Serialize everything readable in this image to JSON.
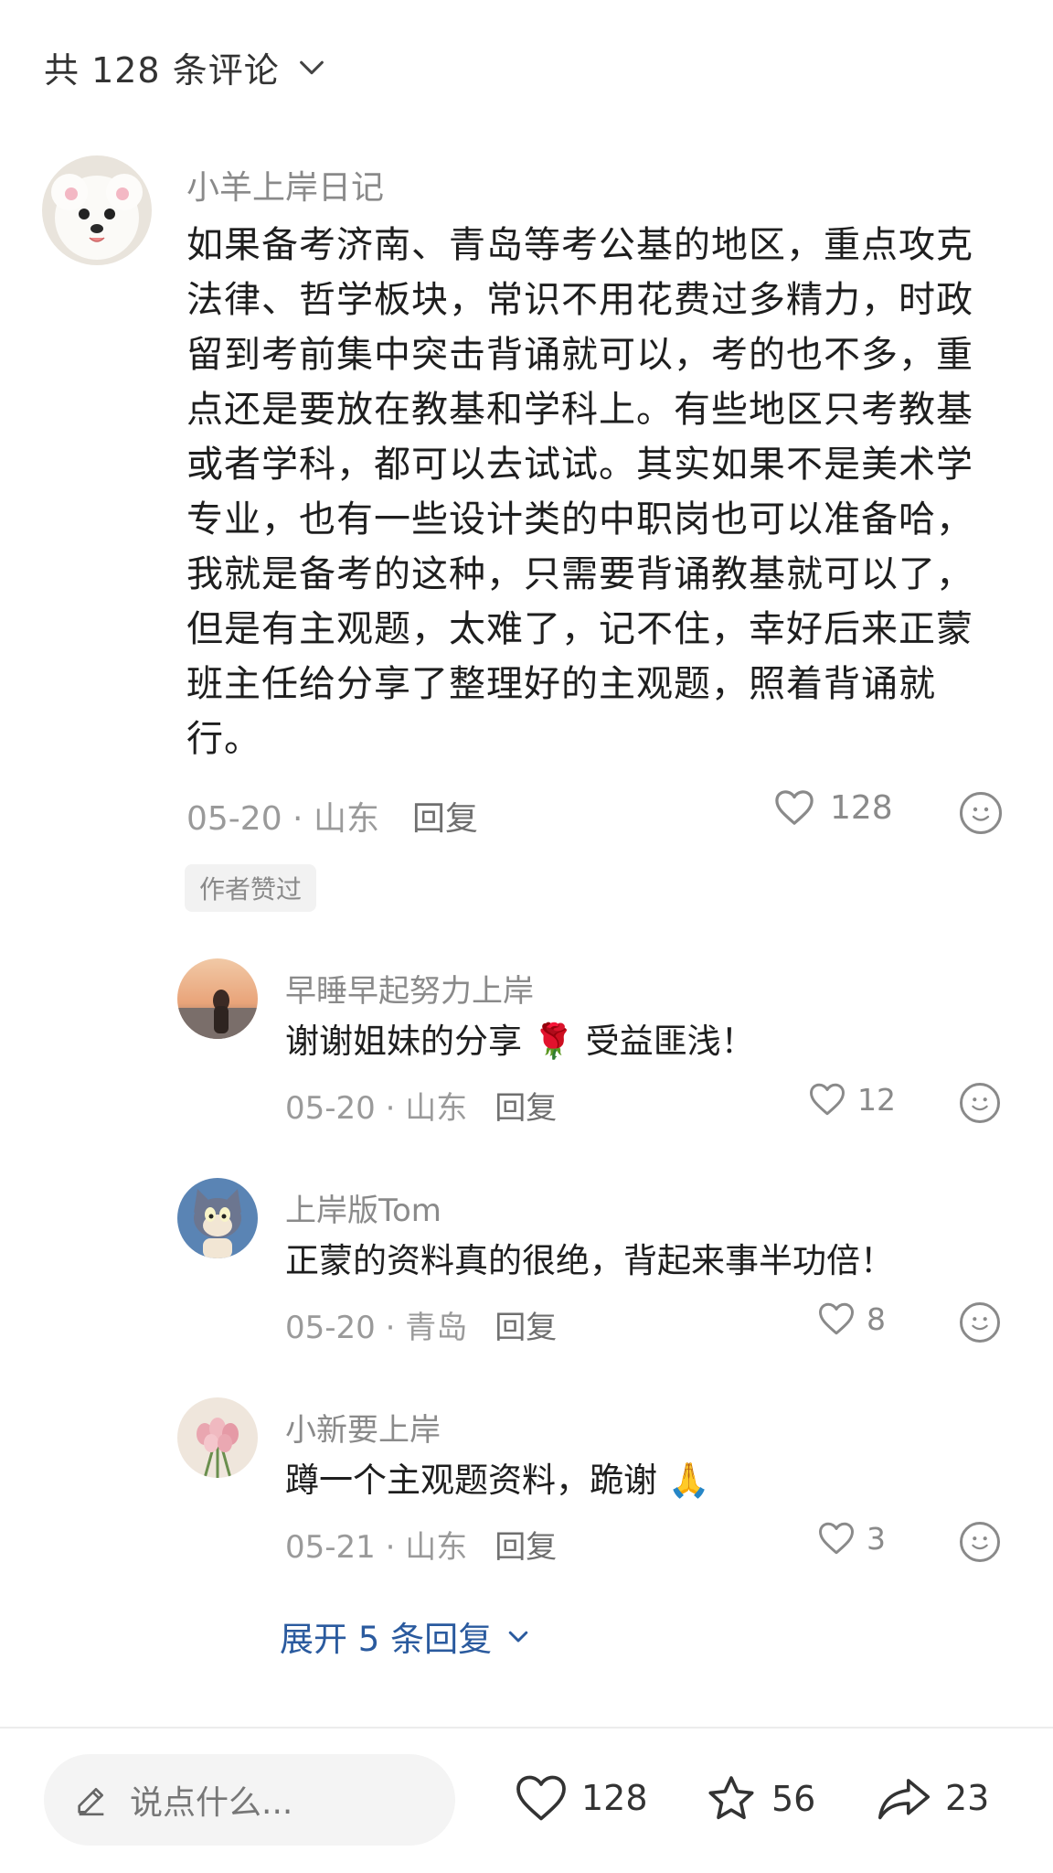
{
  "header": {
    "title": "共 128 条评论"
  },
  "main_comment": {
    "username": "小羊上岸日记",
    "text": "如果备考济南、青岛等考公基的地区，重点攻克法律、哲学板块，常识不用花费过多精力，时政留到考前集中突击背诵就可以，考的也不多，重点还是要放在教基和学科上。有些地区只考教基或者学科，都可以去试试。其实如果不是美术学专业，也有一些设计类的中职岗也可以准备哈，我就是备考的这种，只需要背诵教基就可以了，但是有主观题，太难了，记不住，幸好后来正蒙班主任给分享了整理好的主观题，照着背诵就行。",
    "date_location": "05-20 · 山东",
    "reply_label": "回复",
    "likes": "128",
    "badge": "作者赞过"
  },
  "replies": [
    {
      "username": "早睡早起努力上岸",
      "text": "谢谢姐妹的分享 🌹 受益匪浅！",
      "date_location": "05-20 · 山东",
      "reply_label": "回复",
      "likes": "12"
    },
    {
      "username": "上岸版Tom",
      "text": "正蒙的资料真的很绝，背起来事半功倍！",
      "date_location": "05-20 · 青岛",
      "reply_label": "回复",
      "likes": "8"
    },
    {
      "username": "小新要上岸",
      "text": "蹲一个主观题资料，跪谢 🙏",
      "date_location": "05-21 · 山东",
      "reply_label": "回复",
      "likes": "3"
    }
  ],
  "expand_replies": "展开 5 条回复",
  "bottom_bar": {
    "input_placeholder": "说点什么...",
    "likes": "128",
    "favorites": "56",
    "shares": "23"
  }
}
